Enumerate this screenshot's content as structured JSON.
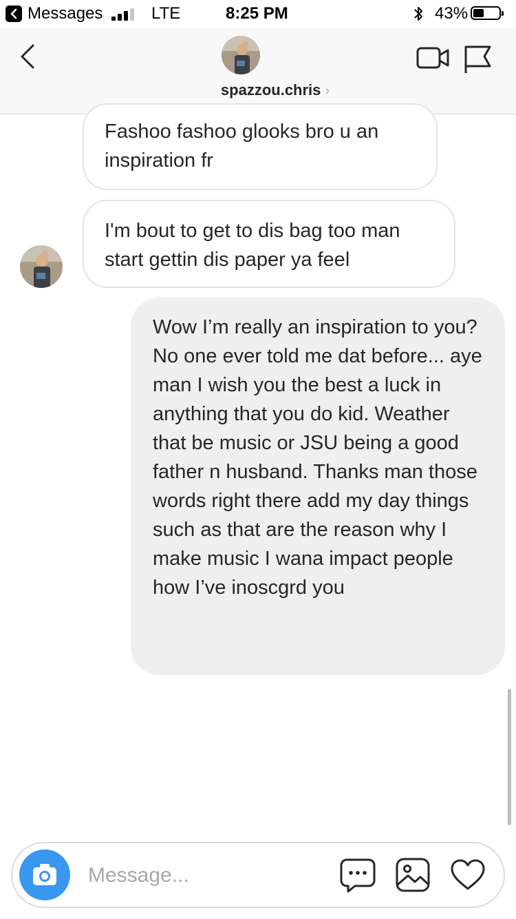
{
  "status_bar": {
    "back_app": "Messages",
    "network": "LTE",
    "time": "8:25 PM",
    "battery_percent": "43%",
    "battery_level": 0.43
  },
  "header": {
    "username": "spazzou.chris",
    "chevron": "›",
    "icons": [
      "back-chevron-icon",
      "avatar",
      "video-call-icon",
      "flag-icon"
    ]
  },
  "messages": [
    {
      "sender": "them",
      "text": "Fashoo fashoo glooks bro u an inspiration fr"
    },
    {
      "sender": "them",
      "text": "I'm bout to get to dis bag too man start gettin dis paper ya feel"
    },
    {
      "sender": "me",
      "text": "Wow I’m really an inspiration to you? No one ever told me dat before... aye man I wish you the best a luck in anything that you do kid. Weather that be music or JSU being a good father n husband. Thanks man those words right there add my day things such as that are the reason why I make music I wana impact people how I’ve inoscgrd you"
    }
  ],
  "composer": {
    "placeholder": "Message...",
    "icons": [
      "camera-icon",
      "chat-bubble-icon",
      "gallery-icon",
      "heart-icon"
    ]
  },
  "colors": {
    "accent": "#3897f0",
    "outgoing_bubble": "#efefef",
    "incoming_border": "#e3e3e3",
    "header_bg": "#f8f8f8"
  }
}
